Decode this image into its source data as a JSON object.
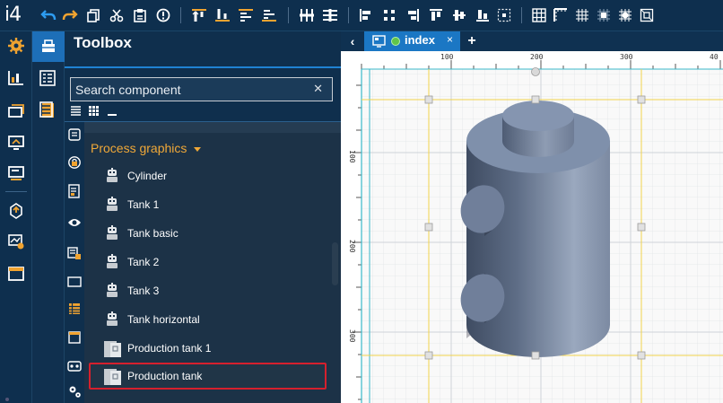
{
  "app": {
    "logo": "i4"
  },
  "toolbar": {
    "icons": [
      "undo-icon",
      "redo-icon",
      "copy-icon",
      "cut-icon",
      "paste-icon",
      "info-icon",
      "align-top-icon",
      "align-bottom-icon",
      "align-vcenter-icon",
      "align-baseline-icon",
      "distribute-horizontal-icon",
      "distribute-vertical-icon",
      "align-left-icon",
      "align-center-icon",
      "align-right-icon",
      "align-top-edge-icon",
      "align-middle-icon",
      "align-bottom-edge-icon",
      "align-page-icon",
      "grid-icon",
      "ruler-icon",
      "snap-grid-icon",
      "snap-objects-icon",
      "grid-settings-icon",
      "fit-icon"
    ]
  },
  "left_rail": {
    "items": [
      "settings-icon",
      "chart-icon",
      "screens-icon",
      "monitor-icon",
      "terminal-icon",
      "box-up-icon",
      "dashboard-settings-icon",
      "window-icon"
    ]
  },
  "toolbox": {
    "title": "Toolbox",
    "search_placeholder": "Search component",
    "search_clear": "✕",
    "group_title": "Process graphics",
    "items": [
      {
        "label": "Cylinder",
        "icon": "robot-icon"
      },
      {
        "label": "Tank 1",
        "icon": "robot-icon"
      },
      {
        "label": "Tank basic",
        "icon": "robot-icon"
      },
      {
        "label": "Tank 2",
        "icon": "robot-icon"
      },
      {
        "label": "Tank 3",
        "icon": "robot-icon"
      },
      {
        "label": "Tank horizontal",
        "icon": "robot-icon"
      },
      {
        "label": "Production tank 1",
        "icon": "component-icon"
      },
      {
        "label": "Production tank",
        "icon": "component-icon"
      }
    ]
  },
  "document": {
    "tab_label": "index",
    "tab_close": "×",
    "tab_add": "+",
    "back": "‹"
  },
  "ruler": {
    "top_labels": [
      "100",
      "200",
      "300",
      "40"
    ],
    "left_labels": [
      "100",
      "200",
      "300"
    ]
  },
  "colors": {
    "accent": "#1f82d2",
    "group_title": "#f0a838",
    "selection_border": "#d6202d",
    "tank_body": "#6b7c97"
  }
}
